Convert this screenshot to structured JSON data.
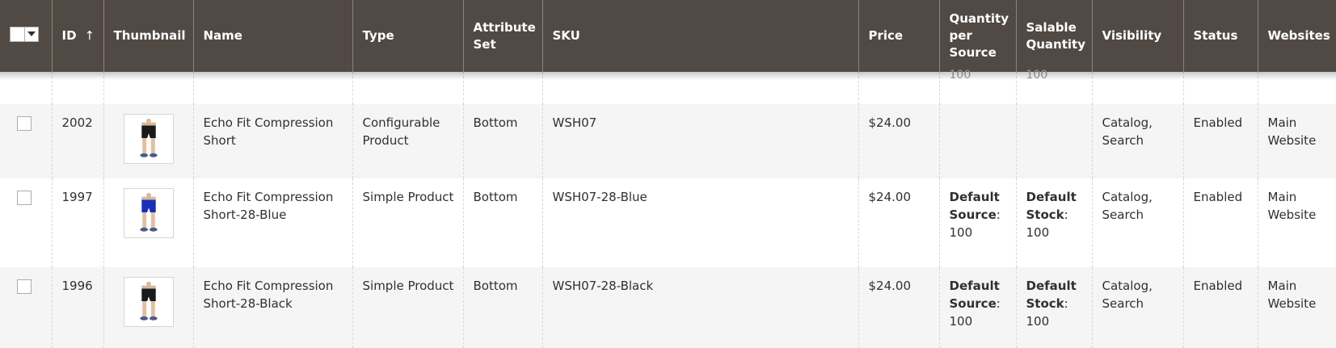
{
  "columns": {
    "id": "ID",
    "sort_arrow": "↑",
    "thumbnail": "Thumbnail",
    "name": "Name",
    "type": "Type",
    "attribute_set": "Attribute Set",
    "sku": "SKU",
    "price": "Price",
    "qty_per_source": "Quantity per Source",
    "salable_quantity": "Salable Quantity",
    "visibility": "Visibility",
    "status": "Status",
    "websites": "Websites"
  },
  "partial_row": {
    "qty_per_source": "100",
    "salable_quantity": "100"
  },
  "rows": [
    {
      "id": "2002",
      "name": "Echo Fit Compression Short",
      "type": "Configurable Product",
      "attribute_set": "Bottom",
      "sku": "WSH07",
      "price": "$24.00",
      "source_label": "",
      "source_qty": "",
      "stock_label": "",
      "stock_qty": "",
      "visibility": "Catalog, Search",
      "status": "Enabled",
      "websites": "Main Website",
      "shorts_color": "#1a1a1a"
    },
    {
      "id": "1997",
      "name": "Echo Fit Compression Short-28-Blue",
      "type": "Simple Product",
      "attribute_set": "Bottom",
      "sku": "WSH07-28-Blue",
      "price": "$24.00",
      "source_label": "Default Source",
      "source_qty": "100",
      "stock_label": "Default Stock",
      "stock_qty": "100",
      "visibility": "Catalog, Search",
      "status": "Enabled",
      "websites": "Main Website",
      "shorts_color": "#1a2fb8"
    },
    {
      "id": "1996",
      "name": "Echo Fit Compression Short-28-Black",
      "type": "Simple Product",
      "attribute_set": "Bottom",
      "sku": "WSH07-28-Black",
      "price": "$24.00",
      "source_label": "Default Source",
      "source_qty": "100",
      "stock_label": "Default Stock",
      "stock_qty": "100",
      "visibility": "Catalog, Search",
      "status": "Enabled",
      "websites": "Main Website",
      "shorts_color": "#1a1a1a"
    }
  ],
  "colors": {
    "header_bg": "#514943",
    "header_text": "#ffffff",
    "row_alt_bg": "#f5f5f5"
  }
}
